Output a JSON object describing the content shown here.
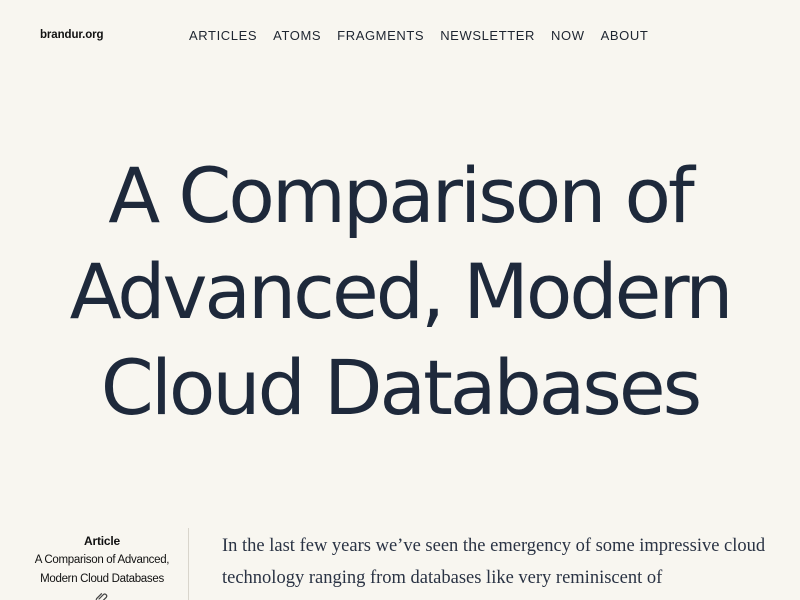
{
  "site": {
    "brand": "brandur.org"
  },
  "nav": {
    "items": [
      {
        "label": "ARTICLES"
      },
      {
        "label": "ATOMS"
      },
      {
        "label": "FRAGMENTS"
      },
      {
        "label": "NEWSLETTER"
      },
      {
        "label": "NOW"
      },
      {
        "label": "ABOUT"
      }
    ]
  },
  "hero": {
    "title_lines": [
      "A Comparison of",
      "Advanced, Modern",
      "Cloud Databases"
    ]
  },
  "sidebar": {
    "kind": "Article",
    "title": "A Comparison of Advanced, Modern Cloud Databases",
    "link_icon": "paperclip-icon"
  },
  "article": {
    "intro": "In the last few years we’ve seen the emergency of some impressive cloud technology ranging from databases like very reminiscent of"
  },
  "colors": {
    "background": "#f8f6f0",
    "heading": "#1e293b",
    "body_text": "#2a3344"
  }
}
